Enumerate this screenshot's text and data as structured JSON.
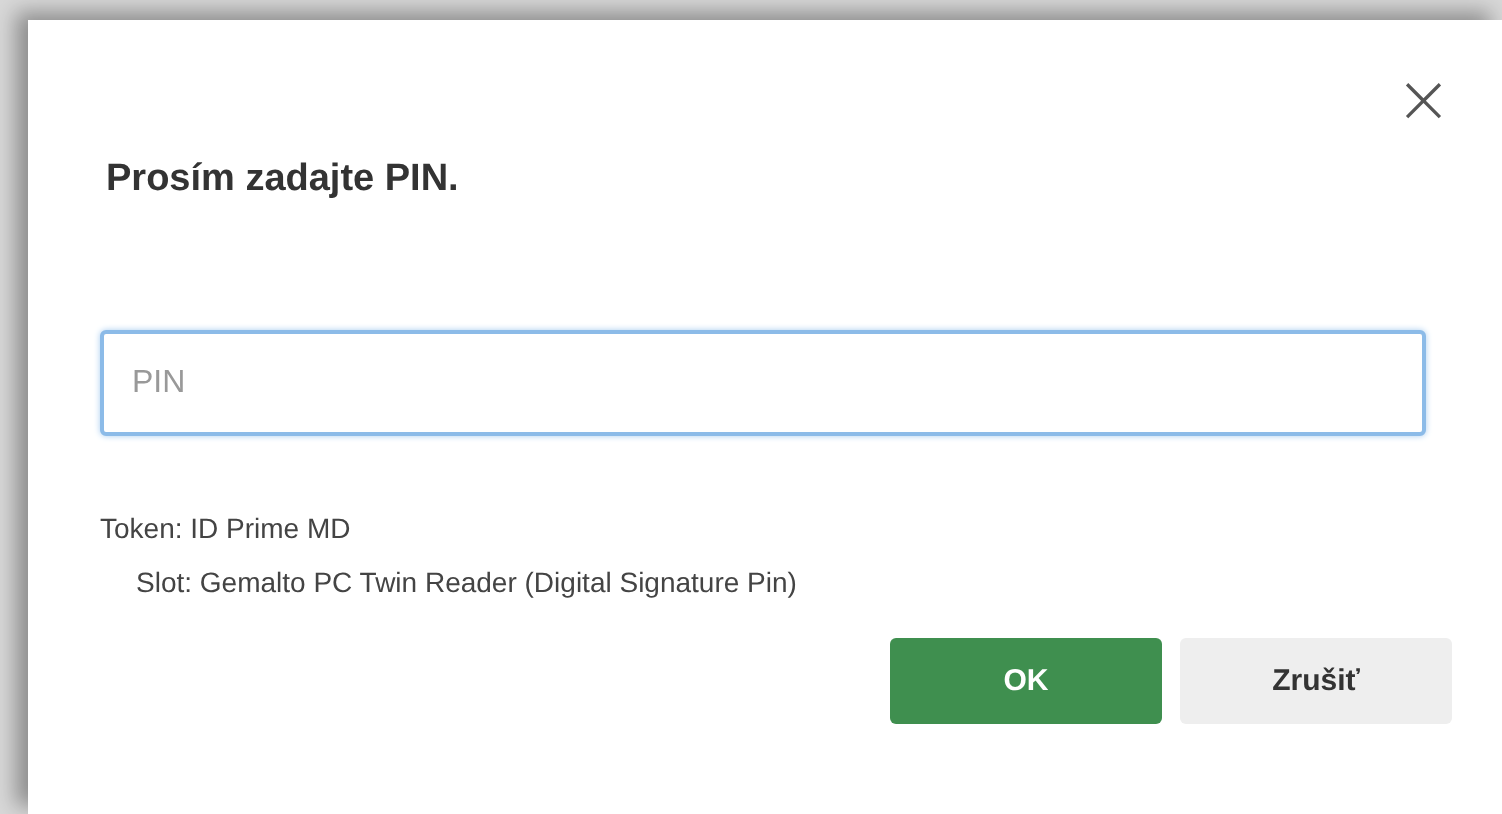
{
  "dialog": {
    "title": "Prosím zadajte PIN.",
    "close": "×",
    "pin_field": {
      "placeholder": "PIN"
    },
    "info": [
      "Token: ID Prime MD",
      "Slot: Gemalto PC Twin Reader (Digital Signature Pin)"
    ],
    "buttons": [
      {
        "label": "OK",
        "kind": "primary"
      },
      {
        "label": "Zrušiť",
        "kind": "secondary"
      }
    ]
  }
}
